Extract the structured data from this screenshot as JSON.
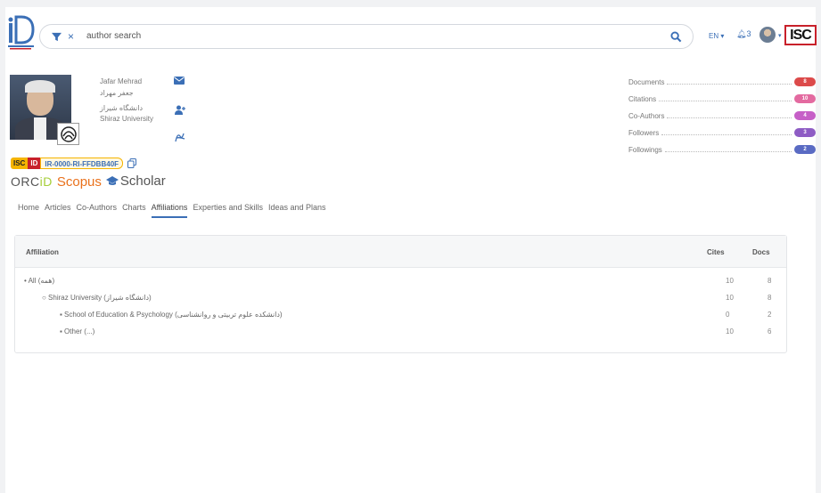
{
  "header": {
    "search_text": "author search",
    "clear_glyph": "×",
    "lang_label": "EN",
    "notif_count": "3",
    "isc_logo_text": "ISC"
  },
  "profile": {
    "name_en": "Jafar Mehrad",
    "name_fa": "جعفر مهراد",
    "uni_fa": "دانشگاه شیراز",
    "uni_en": "Shiraz University",
    "isc_label": "ISC",
    "id_label": "ID",
    "isc_id": "IR-0000-RI-FFDBB40F",
    "orcid_prefix": "ORC",
    "orcid_suffix": "iD",
    "scopus_label": "Scopus",
    "scholar_label": "Scholar"
  },
  "stats": [
    {
      "label": "Documents",
      "value": "8",
      "color": "#dc4a4a"
    },
    {
      "label": "Citations",
      "value": "10",
      "color": "#e36aa0"
    },
    {
      "label": "Co-Authors",
      "value": "4",
      "color": "#c65fc7"
    },
    {
      "label": "Followers",
      "value": "3",
      "color": "#8e5cc4"
    },
    {
      "label": "Followings",
      "value": "2",
      "color": "#5a6bc3"
    }
  ],
  "tabs": [
    {
      "label": "Home"
    },
    {
      "label": "Articles"
    },
    {
      "label": "Co-Authors"
    },
    {
      "label": "Charts"
    },
    {
      "label": "Affiliations"
    },
    {
      "label": "Experties and Skills"
    },
    {
      "label": "Ideas and Plans"
    }
  ],
  "active_tab": "Affiliations",
  "table": {
    "headers": {
      "affiliation": "Affiliation",
      "cites": "Cites",
      "docs": "Docs"
    },
    "rows": [
      {
        "bullet": "•",
        "label": "All (همه)",
        "cites": "10",
        "docs": "8"
      },
      {
        "bullet": "○",
        "label": "Shiraz University (دانشگاه شیراز)",
        "cites": "10",
        "docs": "8"
      },
      {
        "bullet": "▪",
        "label": "School of Education & Psychology (دانشکده علوم تربیتی و روانشناسی)",
        "cites": "0",
        "docs": "2"
      },
      {
        "bullet": "▪",
        "label": "Other (...)",
        "cites": "10",
        "docs": "6"
      }
    ]
  },
  "colors": {
    "accent": "#3b6fb6",
    "isc_red": "#c8202a",
    "isc_yellow": "#f5b400"
  }
}
